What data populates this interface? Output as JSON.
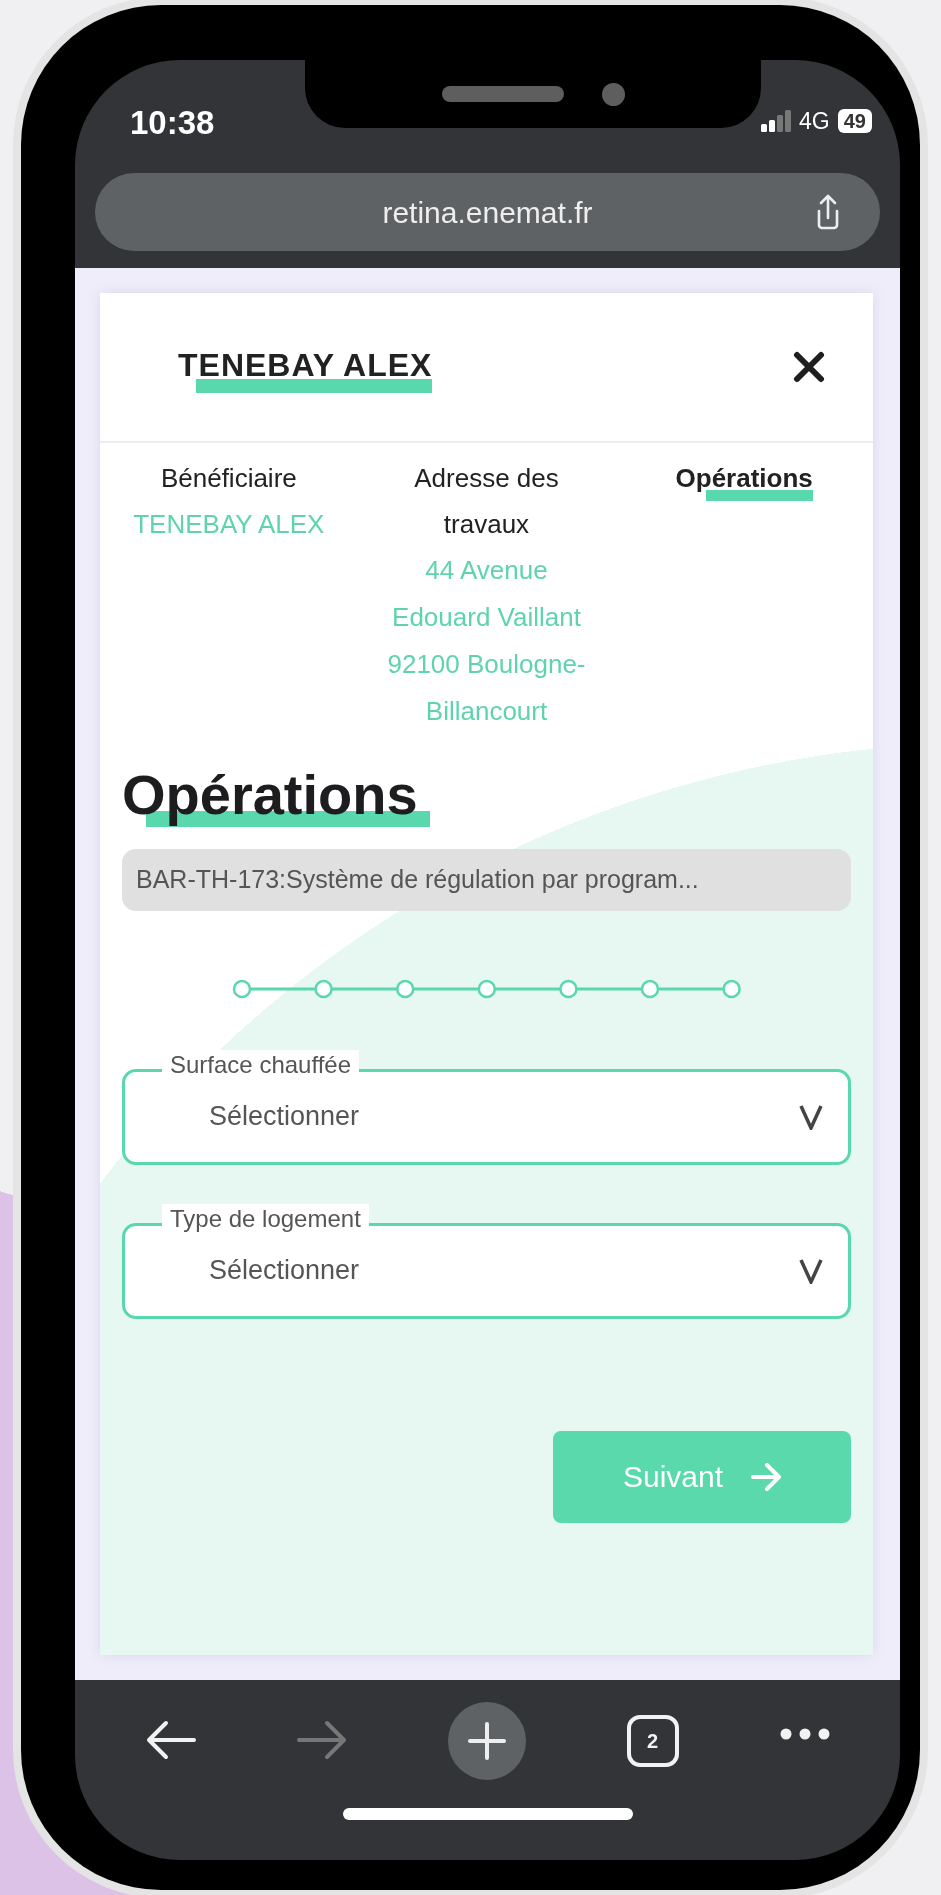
{
  "status_bar": {
    "time": "10:38",
    "network": "4G",
    "battery": "49"
  },
  "browser": {
    "url": "retina.enemat.fr",
    "tab_count": "2"
  },
  "modal": {
    "title": "TENEBAY ALEX",
    "tabs": [
      {
        "label": "Bénéficiaire",
        "selected": false,
        "value": "TENEBAY ALEX"
      },
      {
        "label": "Adresse des travaux",
        "selected": false,
        "value": "44 Avenue Edouard Vaillant 92100 Boulogne-Billancourt"
      },
      {
        "label": "Opérations",
        "selected": true
      }
    ],
    "section_title": "Opérations",
    "operation": "BAR-TH-173:Système de régulation par program...",
    "fields": [
      {
        "label": "Surface chauffée",
        "placeholder": "Sélectionner"
      },
      {
        "label": "Type de logement",
        "placeholder": "Sélectionner"
      }
    ],
    "next_button": "Suivant"
  }
}
